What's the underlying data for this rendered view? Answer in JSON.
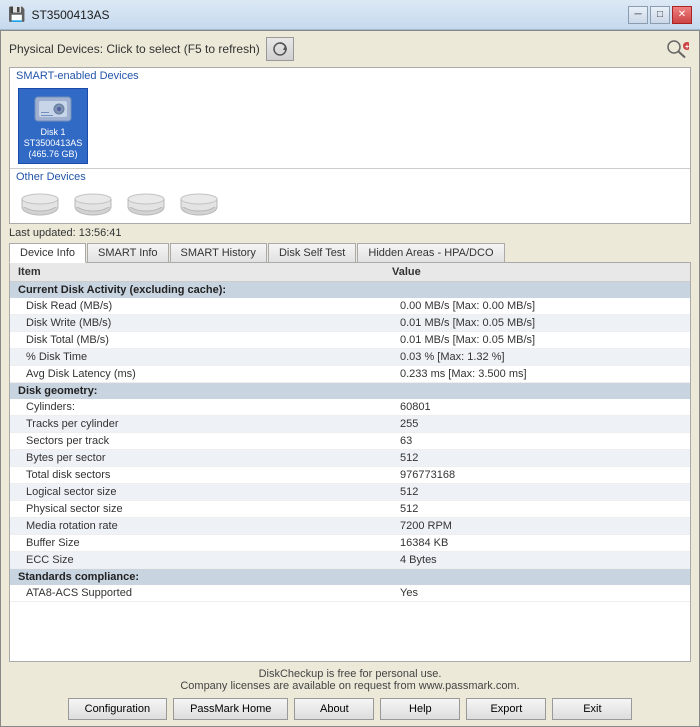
{
  "window": {
    "title": "ST3500413AS",
    "title_icon": "💾"
  },
  "toolbar": {
    "label": "Physical Devices: Click to select (F5 to refresh)",
    "refresh_icon": "🔄",
    "search_icon": "🔍"
  },
  "device_panel": {
    "smart_section_label": "SMART-enabled Devices",
    "smart_devices": [
      {
        "name": "Disk 1\nST3500413AS\n(465.76 GB)",
        "line1": "Disk 1",
        "line2": "ST3500413AS",
        "line3": "(465.76 GB)",
        "selected": true
      }
    ],
    "other_section_label": "Other Devices",
    "other_devices_count": 4
  },
  "last_updated": {
    "label": "Last updated: 13:56:41"
  },
  "tabs": [
    {
      "label": "Device Info",
      "active": true
    },
    {
      "label": "SMART Info",
      "active": false
    },
    {
      "label": "SMART History",
      "active": false
    },
    {
      "label": "Disk Self Test",
      "active": false
    },
    {
      "label": "Hidden Areas - HPA/DCO",
      "active": false
    }
  ],
  "table": {
    "col1": "Item",
    "col2": "Value",
    "rows": [
      {
        "type": "section",
        "item": "Current Disk Activity (excluding cache):",
        "value": ""
      },
      {
        "type": "data",
        "alt": false,
        "item": "Disk Read (MB/s)",
        "value": "0.00 MB/s  [Max: 0.00 MB/s]"
      },
      {
        "type": "data",
        "alt": true,
        "item": "Disk Write (MB/s)",
        "value": "0.01 MB/s  [Max: 0.05 MB/s]"
      },
      {
        "type": "data",
        "alt": false,
        "item": "Disk Total (MB/s)",
        "value": "0.01 MB/s  [Max: 0.05 MB/s]"
      },
      {
        "type": "data",
        "alt": true,
        "item": "% Disk Time",
        "value": "0.03 %    [Max: 1.32 %]"
      },
      {
        "type": "data",
        "alt": false,
        "item": "Avg Disk Latency (ms)",
        "value": "0.233 ms  [Max: 3.500 ms]"
      },
      {
        "type": "section",
        "item": "Disk geometry:",
        "value": ""
      },
      {
        "type": "data",
        "alt": false,
        "item": "Cylinders:",
        "value": "60801"
      },
      {
        "type": "data",
        "alt": true,
        "item": "Tracks per cylinder",
        "value": "255"
      },
      {
        "type": "data",
        "alt": false,
        "item": "Sectors per track",
        "value": "63"
      },
      {
        "type": "data",
        "alt": true,
        "item": "Bytes per sector",
        "value": "512"
      },
      {
        "type": "data",
        "alt": false,
        "item": "Total disk sectors",
        "value": "976773168"
      },
      {
        "type": "data",
        "alt": true,
        "item": "Logical sector size",
        "value": "512"
      },
      {
        "type": "data",
        "alt": false,
        "item": "Physical sector size",
        "value": "512"
      },
      {
        "type": "data",
        "alt": true,
        "item": "Media rotation rate",
        "value": "7200 RPM"
      },
      {
        "type": "data",
        "alt": false,
        "item": "Buffer Size",
        "value": "16384 KB"
      },
      {
        "type": "data",
        "alt": true,
        "item": "ECC Size",
        "value": "4 Bytes"
      },
      {
        "type": "section",
        "item": "Standards compliance:",
        "value": ""
      },
      {
        "type": "data",
        "alt": false,
        "item": "ATA8-ACS Supported",
        "value": "Yes"
      }
    ]
  },
  "footer": {
    "line1": "DiskCheckup is free for personal use.",
    "line2": "Company licenses are available on request from www.passmark.com.",
    "buttons": [
      {
        "id": "config",
        "label": "Configuration"
      },
      {
        "id": "home",
        "label": "PassMark Home"
      },
      {
        "id": "about",
        "label": "About"
      },
      {
        "id": "help",
        "label": "Help"
      },
      {
        "id": "export",
        "label": "Export"
      },
      {
        "id": "exit",
        "label": "Exit"
      }
    ]
  }
}
